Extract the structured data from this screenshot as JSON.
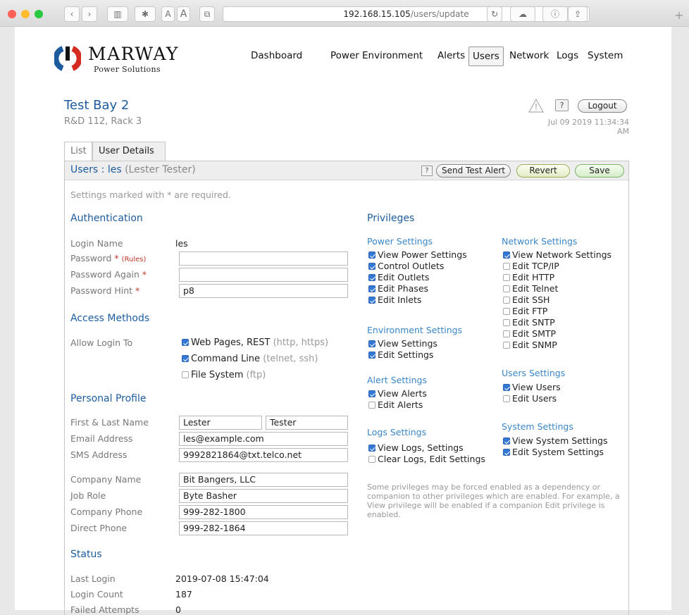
{
  "browser": {
    "url_host": "192.168.15.105",
    "url_path": "/users/update",
    "font_size_small": "A",
    "font_size_large": "A",
    "new_tab": "+",
    "traffic_colors": {
      "close": "#fe5f57",
      "minimize": "#febc2e",
      "zoom": "#28c840"
    }
  },
  "brand": {
    "name": "MARWAY",
    "tagline": "Power Solutions",
    "color": "#1c5b9e"
  },
  "nav": {
    "items": [
      "Dashboard",
      "Power",
      "Environment",
      "Alerts",
      "Users",
      "Network",
      "Logs",
      "System"
    ],
    "active": "Users"
  },
  "header": {
    "title": "Test Bay 2",
    "location": "R&D 112, Rack 3",
    "help_label": "?",
    "logout_label": "Logout",
    "datetime": "Jul 09 2019 11:34:34 AM"
  },
  "tabs": {
    "list": "List",
    "details": "User Details"
  },
  "panel": {
    "title_prefix": "Users : les",
    "title_name": "(Lester Tester)",
    "help_label": "?",
    "send_test_alert": "Send Test Alert",
    "revert": "Revert",
    "save": "Save",
    "required_note": "Settings marked with * are required."
  },
  "authentication": {
    "heading": "Authentication",
    "login_name_label": "Login Name",
    "login_name": "les",
    "password_label": "Password",
    "required_mark": "*",
    "rules": "(Rules)",
    "password_again_label": "Password Again",
    "password_hint_label": "Password Hint",
    "password_hint": "p8"
  },
  "access": {
    "heading": "Access Methods",
    "allow_label": "Allow Login To",
    "methods": [
      {
        "label": "Web Pages, REST",
        "hint": "(http, https)",
        "checked": true
      },
      {
        "label": "Command Line",
        "hint": "(telnet, ssh)",
        "checked": true
      },
      {
        "label": "File System",
        "hint": "(ftp)",
        "checked": false
      }
    ]
  },
  "profile": {
    "heading": "Personal Profile",
    "name_label": "First & Last Name",
    "first_name": "Lester",
    "last_name": "Tester",
    "email_label": "Email Address",
    "email": "les@example.com",
    "sms_label": "SMS Address",
    "sms": "9992821864@txt.telco.net",
    "company_label": "Company Name",
    "company": "Bit Bangers, LLC",
    "role_label": "Job Role",
    "role": "Byte Basher",
    "company_phone_label": "Company Phone",
    "company_phone": "999-282-1800",
    "direct_phone_label": "Direct Phone",
    "direct_phone": "999-282-1864"
  },
  "status": {
    "heading": "Status",
    "last_login_label": "Last Login",
    "last_login": "2019-07-08 15:47:04",
    "login_count_label": "Login Count",
    "login_count": "187",
    "failed_label": "Failed Attempts",
    "failed": "0"
  },
  "privileges": {
    "heading": "Privileges",
    "power": {
      "title": "Power Settings",
      "items": [
        {
          "label": "View Power Settings",
          "checked": true
        },
        {
          "label": "Control Outlets",
          "checked": true
        },
        {
          "label": "Edit Outlets",
          "checked": true
        },
        {
          "label": "Edit Phases",
          "checked": true
        },
        {
          "label": "Edit Inlets",
          "checked": true
        }
      ]
    },
    "environment": {
      "title": "Environment Settings",
      "items": [
        {
          "label": "View Settings",
          "checked": true
        },
        {
          "label": "Edit Settings",
          "checked": true
        }
      ]
    },
    "alert": {
      "title": "Alert Settings",
      "items": [
        {
          "label": "View Alerts",
          "checked": true
        },
        {
          "label": "Edit Alerts",
          "checked": false
        }
      ]
    },
    "logs": {
      "title": "Logs Settings",
      "items": [
        {
          "label": "View Logs, Settings",
          "checked": true
        },
        {
          "label": "Clear Logs, Edit Settings",
          "checked": false
        }
      ]
    },
    "network": {
      "title": "Network Settings",
      "items": [
        {
          "label": "View Network Settings",
          "checked": true
        },
        {
          "label": "Edit TCP/IP",
          "checked": false
        },
        {
          "label": "Edit HTTP",
          "checked": false
        },
        {
          "label": "Edit Telnet",
          "checked": false
        },
        {
          "label": "Edit SSH",
          "checked": false
        },
        {
          "label": "Edit FTP",
          "checked": false
        },
        {
          "label": "Edit SNTP",
          "checked": false
        },
        {
          "label": "Edit SMTP",
          "checked": false
        },
        {
          "label": "Edit SNMP",
          "checked": false
        }
      ]
    },
    "users": {
      "title": "Users Settings",
      "items": [
        {
          "label": "View Users",
          "checked": true
        },
        {
          "label": "Edit Users",
          "checked": false
        }
      ]
    },
    "system": {
      "title": "System Settings",
      "items": [
        {
          "label": "View System Settings",
          "checked": true
        },
        {
          "label": "Edit System Settings",
          "checked": true
        }
      ]
    },
    "note": "Some privileges may be forced enabled as a dependency or companion to other privileges which are enabled. For example, a View privilege will be enabled if a companion Edit privilege is enabled."
  }
}
